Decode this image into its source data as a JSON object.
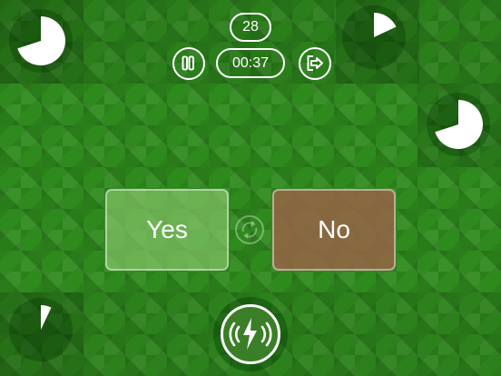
{
  "hud": {
    "score": "28",
    "time": "00:37"
  },
  "answers": {
    "yes_label": "Yes",
    "no_label": "No"
  },
  "timers": {
    "top_left_fraction": 0.7,
    "top_right_fraction": 0.18,
    "middle_right_fraction": 0.7,
    "bottom_left_fraction": 0.07
  },
  "icons": {
    "pause": "pause-icon",
    "exit": "exit-icon",
    "swap": "swap-icon",
    "power": "lightning-wave-icon"
  },
  "colors": {
    "background": "#2f8a1e",
    "yes": "#8cc86e",
    "no": "#96644b",
    "foreground": "#ffffff"
  }
}
